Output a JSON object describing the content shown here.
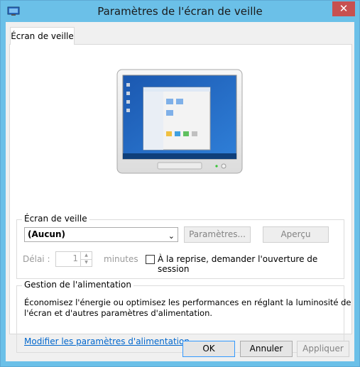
{
  "window": {
    "title": "Paramètres de l'écran de veille",
    "close_glyph": "✕"
  },
  "tabs": [
    {
      "label": "Écran de veille",
      "selected": true
    }
  ],
  "screensaver": {
    "group_label": "Écran de veille",
    "selected": "(Aucun)",
    "settings_button": "Paramètres...",
    "preview_button": "Aperçu",
    "delay_label": "Délai :",
    "delay_value": "1",
    "minutes_label": "minutes",
    "resume_label": "À la reprise, demander l'ouverture de session",
    "resume_checked": false
  },
  "power": {
    "group_label": "Gestion de l'alimentation",
    "description_line1": "Économisez l'énergie ou optimisez les performances en réglant la luminosité de",
    "description_line2": "l'écran et d'autres paramètres d'alimentation.",
    "link": "Modifier les paramètres d'alimentation"
  },
  "footer": {
    "ok": "OK",
    "cancel": "Annuler",
    "apply": "Appliquer"
  },
  "colors": {
    "frame": "#6bc0e8",
    "close_button": "#c75050",
    "link": "#0066cc",
    "desktop_blue": "#1e5fb8"
  }
}
